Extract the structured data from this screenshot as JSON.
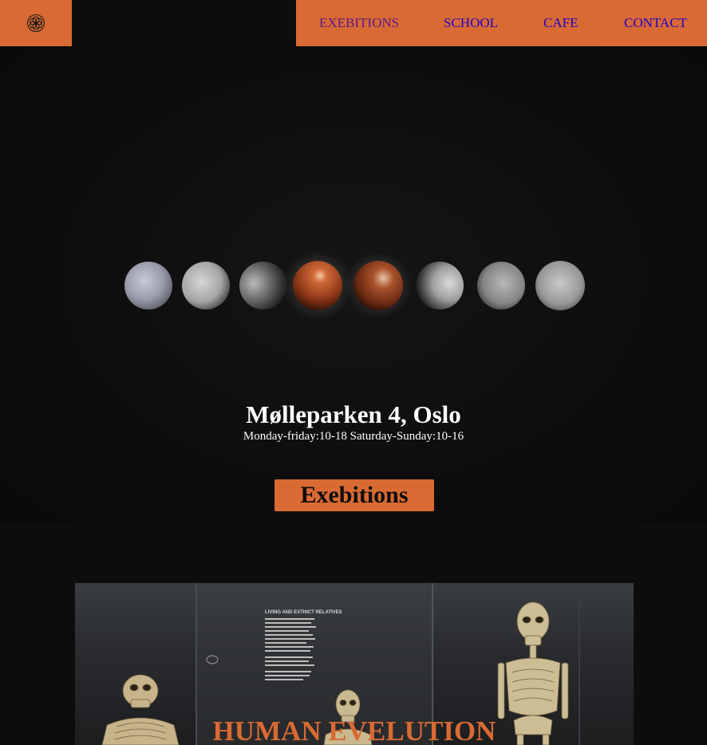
{
  "header": {
    "logo_icon": "flower-of-life-icon",
    "nav": [
      {
        "label": "EXEBITIONS",
        "state": "visited"
      },
      {
        "label": "SCHOOL",
        "state": "link"
      },
      {
        "label": "CAFE",
        "state": "link"
      },
      {
        "label": "CONTACT",
        "state": "link"
      }
    ]
  },
  "hero": {
    "image": "lunar-eclipse-phases",
    "address": "Mølleparken 4, Oslo",
    "hours": "Monday-friday:10-18 Saturday-Sunday:10-16",
    "button_label": "Exebitions"
  },
  "exhibit": {
    "image": "hominid-skeletons-display",
    "title": "HUMAN EVELUTION",
    "placard_heading": "LIVING AND EXTINCT RELATIVES"
  },
  "colors": {
    "accent": "#d96a33",
    "background": "#0d0d0d",
    "text_light": "#ffffff",
    "link": "#2200cc",
    "link_visited": "#5b1a8a"
  }
}
